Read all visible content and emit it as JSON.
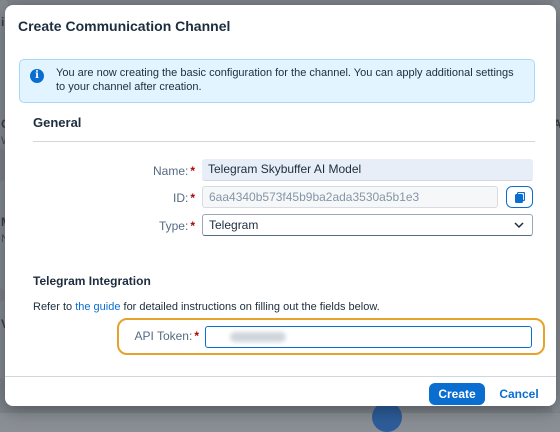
{
  "dialog": {
    "title": "Create Communication Channel",
    "info_message": "You are now creating the basic configuration for the channel. You can apply additional settings to your channel after creation.",
    "section_title": "General",
    "fields": {
      "name_label": "Name:",
      "name_value": "Telegram Skybuffer AI Model",
      "id_label": "ID:",
      "id_value": "6aa4340b573f45b9ba2ada3530a5b1e3",
      "type_label": "Type:",
      "type_value": "Telegram"
    },
    "required_marker": "*",
    "integration": {
      "title": "Telegram Integration",
      "refer_prefix": "Refer to ",
      "guide_link": "the guide",
      "refer_suffix": " for detailed instructions on filling out the fields below.",
      "api_token_label": "API Token:",
      "api_token_value": "(hidden)"
    },
    "buttons": {
      "create": "Create",
      "cancel": "Cancel"
    }
  },
  "background": {
    "letters": [
      "i",
      "C",
      "W",
      "M",
      "N",
      "V",
      "A"
    ]
  },
  "colors": {
    "accent": "#0a6ed1",
    "required": "#aa0808",
    "highlight": "#e7a22a",
    "info_bg": "#e1f4ff"
  },
  "icons": {
    "info": "info-icon",
    "copy": "copy-icon",
    "dropdown": "chevron-down-icon"
  }
}
